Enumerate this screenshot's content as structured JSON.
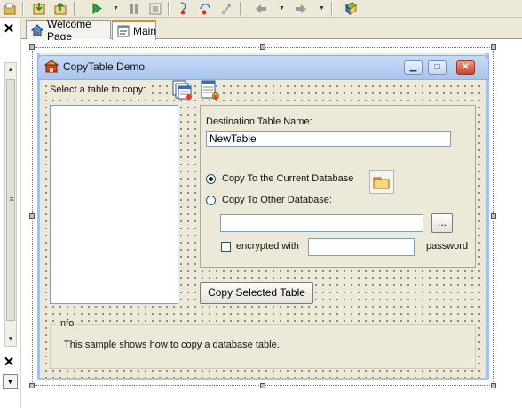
{
  "tabs": [
    {
      "label": "Welcome Page"
    },
    {
      "label": "Main"
    }
  ],
  "form": {
    "title": "CopyTable Demo",
    "select_table_label": "Select a table to copy:",
    "destination_label": "Destination Table Name:",
    "destination_value": "NewTable",
    "radio_current_label": "Copy To the Current Database",
    "radio_other_label": "Copy To Other Database:",
    "other_db_value": "",
    "browse_label": "...",
    "encrypted_label": "encrypted with",
    "password_value": "",
    "password_label": "password",
    "copy_button_label": "Copy Selected Table",
    "info_title": "Info",
    "info_text": "This sample shows how to copy a database table."
  },
  "toolbar_icons": [
    "open-icon",
    "save-icon",
    "open-folder-icon",
    "run-icon",
    "pause-icon",
    "stop-icon",
    "step-into-icon",
    "step-over-icon",
    "step-out-icon",
    "back-icon",
    "forward-icon",
    "book-icon"
  ],
  "colors": {
    "accent_tab": "#e68b2c",
    "titlebar": "#a9c5ec",
    "form_bg": "#ece9d8"
  }
}
